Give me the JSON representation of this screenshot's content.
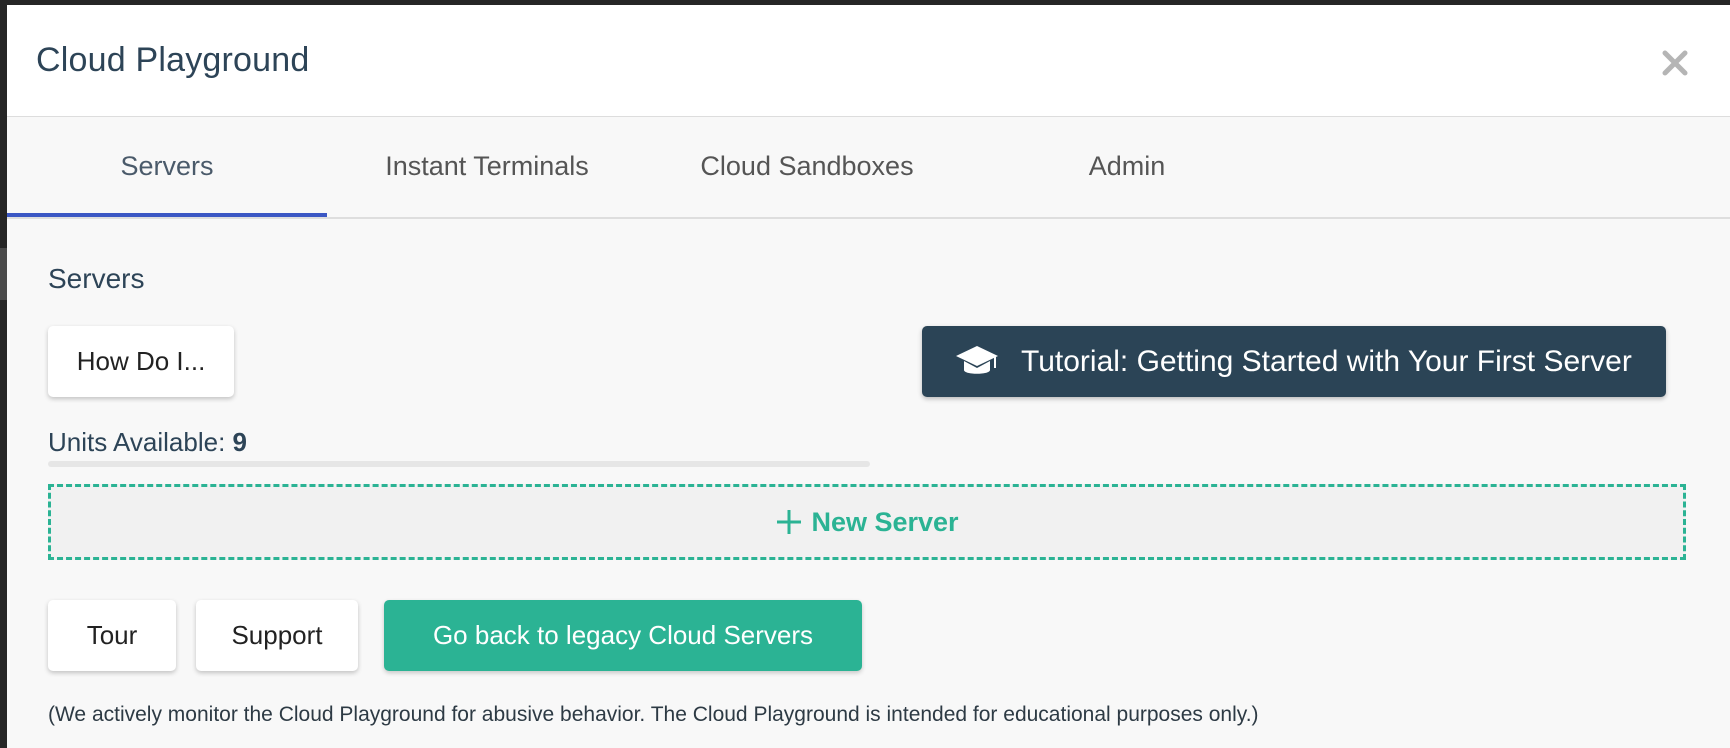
{
  "modal": {
    "title": "Cloud Playground",
    "close_icon": "close-icon"
  },
  "tabs": [
    {
      "label": "Servers",
      "active": true
    },
    {
      "label": "Instant Terminals",
      "active": false
    },
    {
      "label": "Cloud Sandboxes",
      "active": false
    },
    {
      "label": "Admin",
      "active": false
    }
  ],
  "servers": {
    "section_title": "Servers",
    "how_do_i_label": "How Do I...",
    "tutorial": {
      "icon": "graduation-cap-icon",
      "label": "Tutorial: Getting Started with Your First Server"
    },
    "units_label": "Units Available:",
    "units_value": "9",
    "new_server": {
      "icon": "plus-icon",
      "label": "New Server"
    }
  },
  "footer": {
    "tour_label": "Tour",
    "support_label": "Support",
    "legacy_label": "Go back to legacy Cloud Servers",
    "disclaimer": "(We actively monitor the Cloud Playground for abusive behavior. The Cloud Playground is intended for educational purposes only.)"
  },
  "colors": {
    "accent_green": "#2bb394",
    "navy": "#2b4456",
    "tab_underline": "#3b57c4"
  }
}
